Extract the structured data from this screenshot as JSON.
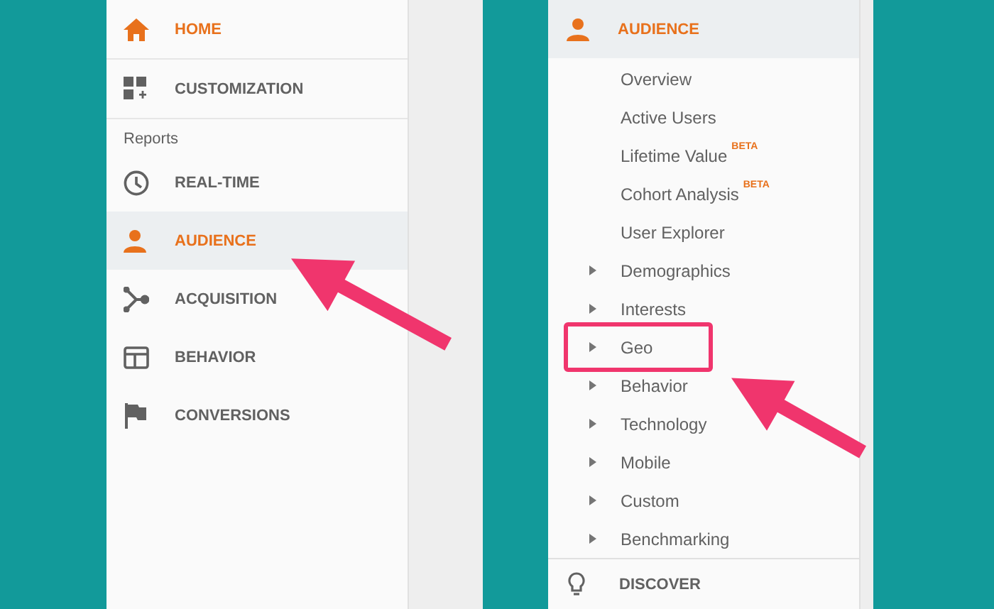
{
  "left_sidebar": {
    "top_items": [
      {
        "label": "HOME",
        "active": true,
        "selected": false
      },
      {
        "label": "CUSTOMIZATION",
        "active": false,
        "selected": false
      }
    ],
    "section_label": "Reports",
    "report_items": [
      {
        "label": "REAL-TIME",
        "active": false,
        "selected": false
      },
      {
        "label": "AUDIENCE",
        "active": true,
        "selected": true
      },
      {
        "label": "ACQUISITION",
        "active": false,
        "selected": false
      },
      {
        "label": "BEHAVIOR",
        "active": false,
        "selected": false
      },
      {
        "label": "CONVERSIONS",
        "active": false,
        "selected": false
      }
    ]
  },
  "right_sidebar": {
    "header": {
      "label": "AUDIENCE",
      "active": true,
      "selected": true
    },
    "items": [
      {
        "label": "Overview",
        "expandable": false,
        "highlighted": false
      },
      {
        "label": "Active Users",
        "expandable": false,
        "highlighted": false
      },
      {
        "label": "Lifetime Value",
        "badge": "BETA",
        "expandable": false,
        "highlighted": false
      },
      {
        "label": "Cohort Analysis",
        "badge": "BETA",
        "expandable": false,
        "highlighted": false
      },
      {
        "label": "User Explorer",
        "expandable": false,
        "highlighted": false
      },
      {
        "label": "Demographics",
        "expandable": true,
        "highlighted": false
      },
      {
        "label": "Interests",
        "expandable": true,
        "highlighted": false
      },
      {
        "label": "Geo",
        "expandable": true,
        "highlighted": true
      },
      {
        "label": "Behavior",
        "expandable": true,
        "highlighted": false
      },
      {
        "label": "Technology",
        "expandable": true,
        "highlighted": false
      },
      {
        "label": "Mobile",
        "expandable": true,
        "highlighted": false
      },
      {
        "label": "Custom",
        "expandable": true,
        "highlighted": false
      },
      {
        "label": "Benchmarking",
        "expandable": true,
        "highlighted": false
      }
    ],
    "footer": {
      "label": "DISCOVER"
    }
  }
}
